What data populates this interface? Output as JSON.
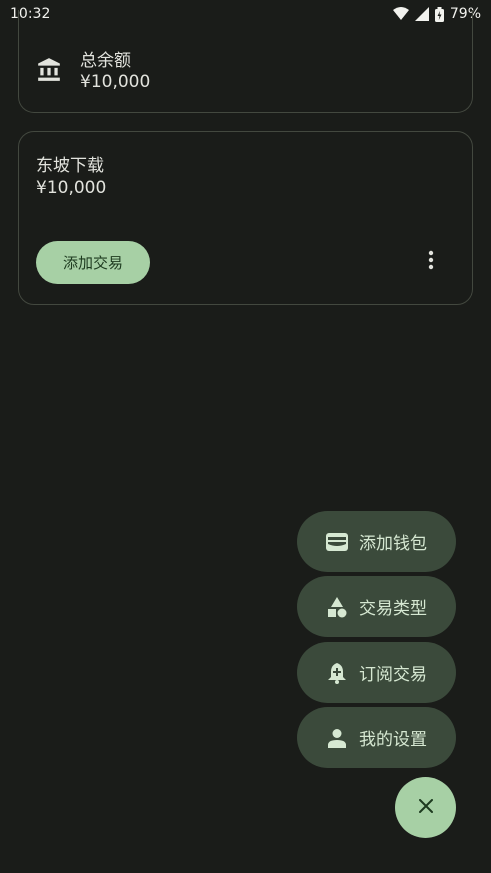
{
  "status_bar": {
    "time": "10:32",
    "battery": "79%"
  },
  "summary": {
    "label": "总余额",
    "value": "¥10,000",
    "icon": "bank-icon"
  },
  "wallet": {
    "name": "东坡下载",
    "balance": "¥10,000",
    "add_transaction_label": "添加交易"
  },
  "fab_menu": {
    "items": [
      {
        "label": "添加钱包",
        "icon": "wallet-icon"
      },
      {
        "label": "交易类型",
        "icon": "category-shapes-icon"
      },
      {
        "label": "订阅交易",
        "icon": "subscription-bell-icon"
      },
      {
        "label": "我的设置",
        "icon": "person-icon"
      }
    ],
    "close_icon": "close-icon"
  },
  "colors": {
    "background": "#1a1c19",
    "accent": "#a7d0a5",
    "menu_item_bg": "#3b4a3b"
  }
}
